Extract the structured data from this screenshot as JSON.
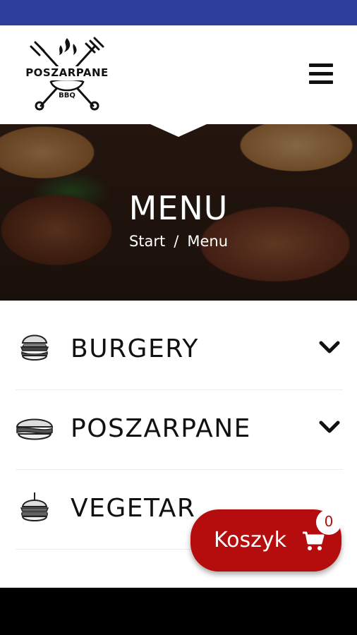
{
  "header": {
    "logo_text": "POSZARPANE",
    "logo_sub": "BBQ"
  },
  "hero": {
    "title": "MENU",
    "breadcrumb": {
      "start": "Start",
      "separator": "/",
      "current": "Menu"
    }
  },
  "menu": {
    "items": [
      {
        "label": "BURGERY",
        "icon": "burger-icon"
      },
      {
        "label": "POSZARPANE",
        "icon": "sandwich-icon"
      },
      {
        "label": "VEGETAR",
        "icon": "veggie-burger-icon"
      }
    ]
  },
  "cart": {
    "label": "Koszyk",
    "count": "0",
    "color": "#b50d0d"
  },
  "colors": {
    "status_bar": "#2d3e9a",
    "accent": "#b50d0d"
  }
}
